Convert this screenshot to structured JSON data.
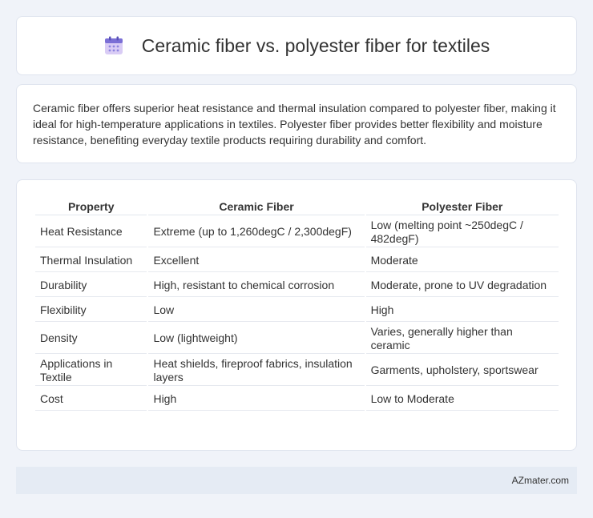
{
  "header": {
    "title": "Ceramic fiber vs. polyester fiber for textiles",
    "icon": "calendar-icon",
    "icon_colors": {
      "body": "#c9b8f0",
      "top": "#7b6fd6",
      "dots": "#8e84e0"
    }
  },
  "summary": {
    "text": "Ceramic fiber offers superior heat resistance and thermal insulation compared to polyester fiber, making it ideal for high-temperature applications in textiles. Polyester fiber provides better flexibility and moisture resistance, benefiting everyday textile products requiring durability and comfort."
  },
  "table": {
    "headers": [
      "Property",
      "Ceramic Fiber",
      "Polyester Fiber"
    ],
    "rows": [
      [
        "Heat Resistance",
        "Extreme (up to 1,260degC / 2,300degF)",
        "Low (melting point ~250degC / 482degF)"
      ],
      [
        "Thermal Insulation",
        "Excellent",
        "Moderate"
      ],
      [
        "Durability",
        "High, resistant to chemical corrosion",
        "Moderate, prone to UV degradation"
      ],
      [
        "Flexibility",
        "Low",
        "High"
      ],
      [
        "Density",
        "Low (lightweight)",
        "Varies, generally higher than ceramic"
      ],
      [
        "Applications in Textile",
        "Heat shields, fireproof fabrics, insulation layers",
        "Garments, upholstery, sportswear"
      ],
      [
        "Cost",
        "High",
        "Low to Moderate"
      ]
    ]
  },
  "footer": {
    "text": "AZmater.com"
  },
  "colors": {
    "page_background": "#f0f3f9",
    "card_background": "#ffffff",
    "footer_background": "#e5ebf4",
    "text": "#333333"
  }
}
